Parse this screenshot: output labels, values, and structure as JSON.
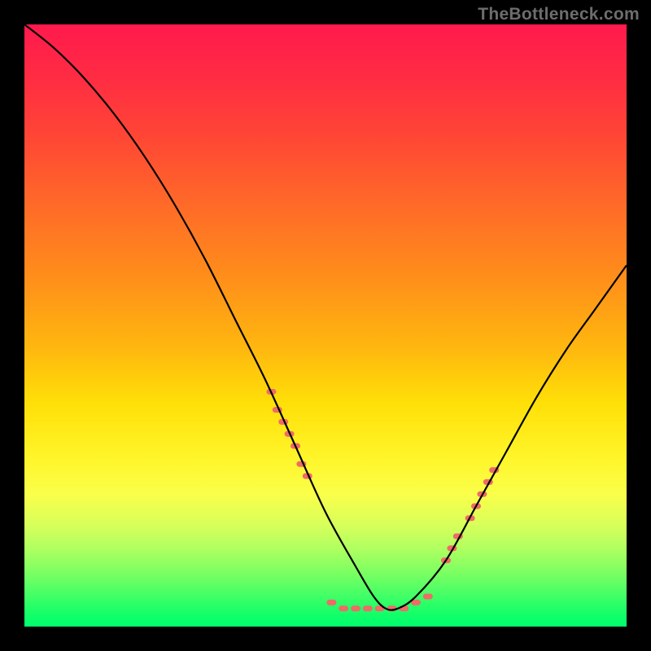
{
  "watermark": "TheBottleneck.com",
  "colors": {
    "frame_bg": "#000000",
    "marker": "#ef6b67",
    "curve": "#000000"
  },
  "chart_data": {
    "type": "line",
    "title": "",
    "xlabel": "",
    "ylabel": "",
    "xlim": [
      0,
      100
    ],
    "ylim": [
      0,
      100
    ],
    "notes": "Smooth V-shaped bottleneck curve on a vertical rainbow gradient (red at top = high bottleneck, green at bottom = low). Curve descends from top-left, bottoms out near x≈60, rises toward upper-right. Short salmon dash markers cluster along the descent near x≈40–47 and along the ascent near x≈70–78; a horizontal row of salmon dashes sits along the valley floor x≈50–66.",
    "series": [
      {
        "name": "bottleneck-curve",
        "x": [
          0,
          5,
          10,
          15,
          20,
          25,
          30,
          35,
          40,
          45,
          50,
          55,
          58,
          60,
          62,
          65,
          70,
          75,
          80,
          85,
          90,
          95,
          100
        ],
        "y": [
          100,
          96,
          91,
          85,
          78,
          70,
          61,
          51,
          41,
          30,
          19,
          10,
          5,
          3,
          3,
          5,
          11,
          20,
          29,
          38,
          46,
          53,
          60
        ]
      }
    ],
    "markers": [
      {
        "group": "left-descent",
        "x": 41,
        "y": 39
      },
      {
        "group": "left-descent",
        "x": 42,
        "y": 36
      },
      {
        "group": "left-descent",
        "x": 43,
        "y": 34
      },
      {
        "group": "left-descent",
        "x": 44,
        "y": 32
      },
      {
        "group": "left-descent",
        "x": 45,
        "y": 30
      },
      {
        "group": "left-descent",
        "x": 46,
        "y": 27
      },
      {
        "group": "left-descent",
        "x": 47,
        "y": 25
      },
      {
        "group": "valley",
        "x": 51,
        "y": 4
      },
      {
        "group": "valley",
        "x": 53,
        "y": 3
      },
      {
        "group": "valley",
        "x": 55,
        "y": 3
      },
      {
        "group": "valley",
        "x": 57,
        "y": 3
      },
      {
        "group": "valley",
        "x": 59,
        "y": 3
      },
      {
        "group": "valley",
        "x": 61,
        "y": 3
      },
      {
        "group": "valley",
        "x": 63,
        "y": 3
      },
      {
        "group": "valley",
        "x": 65,
        "y": 4
      },
      {
        "group": "valley",
        "x": 67,
        "y": 5
      },
      {
        "group": "right-ascent",
        "x": 70,
        "y": 11
      },
      {
        "group": "right-ascent",
        "x": 71,
        "y": 13
      },
      {
        "group": "right-ascent",
        "x": 72,
        "y": 15
      },
      {
        "group": "right-ascent",
        "x": 74,
        "y": 18
      },
      {
        "group": "right-ascent",
        "x": 75,
        "y": 20
      },
      {
        "group": "right-ascent",
        "x": 76,
        "y": 22
      },
      {
        "group": "right-ascent",
        "x": 77,
        "y": 24
      },
      {
        "group": "right-ascent",
        "x": 78,
        "y": 26
      }
    ]
  }
}
